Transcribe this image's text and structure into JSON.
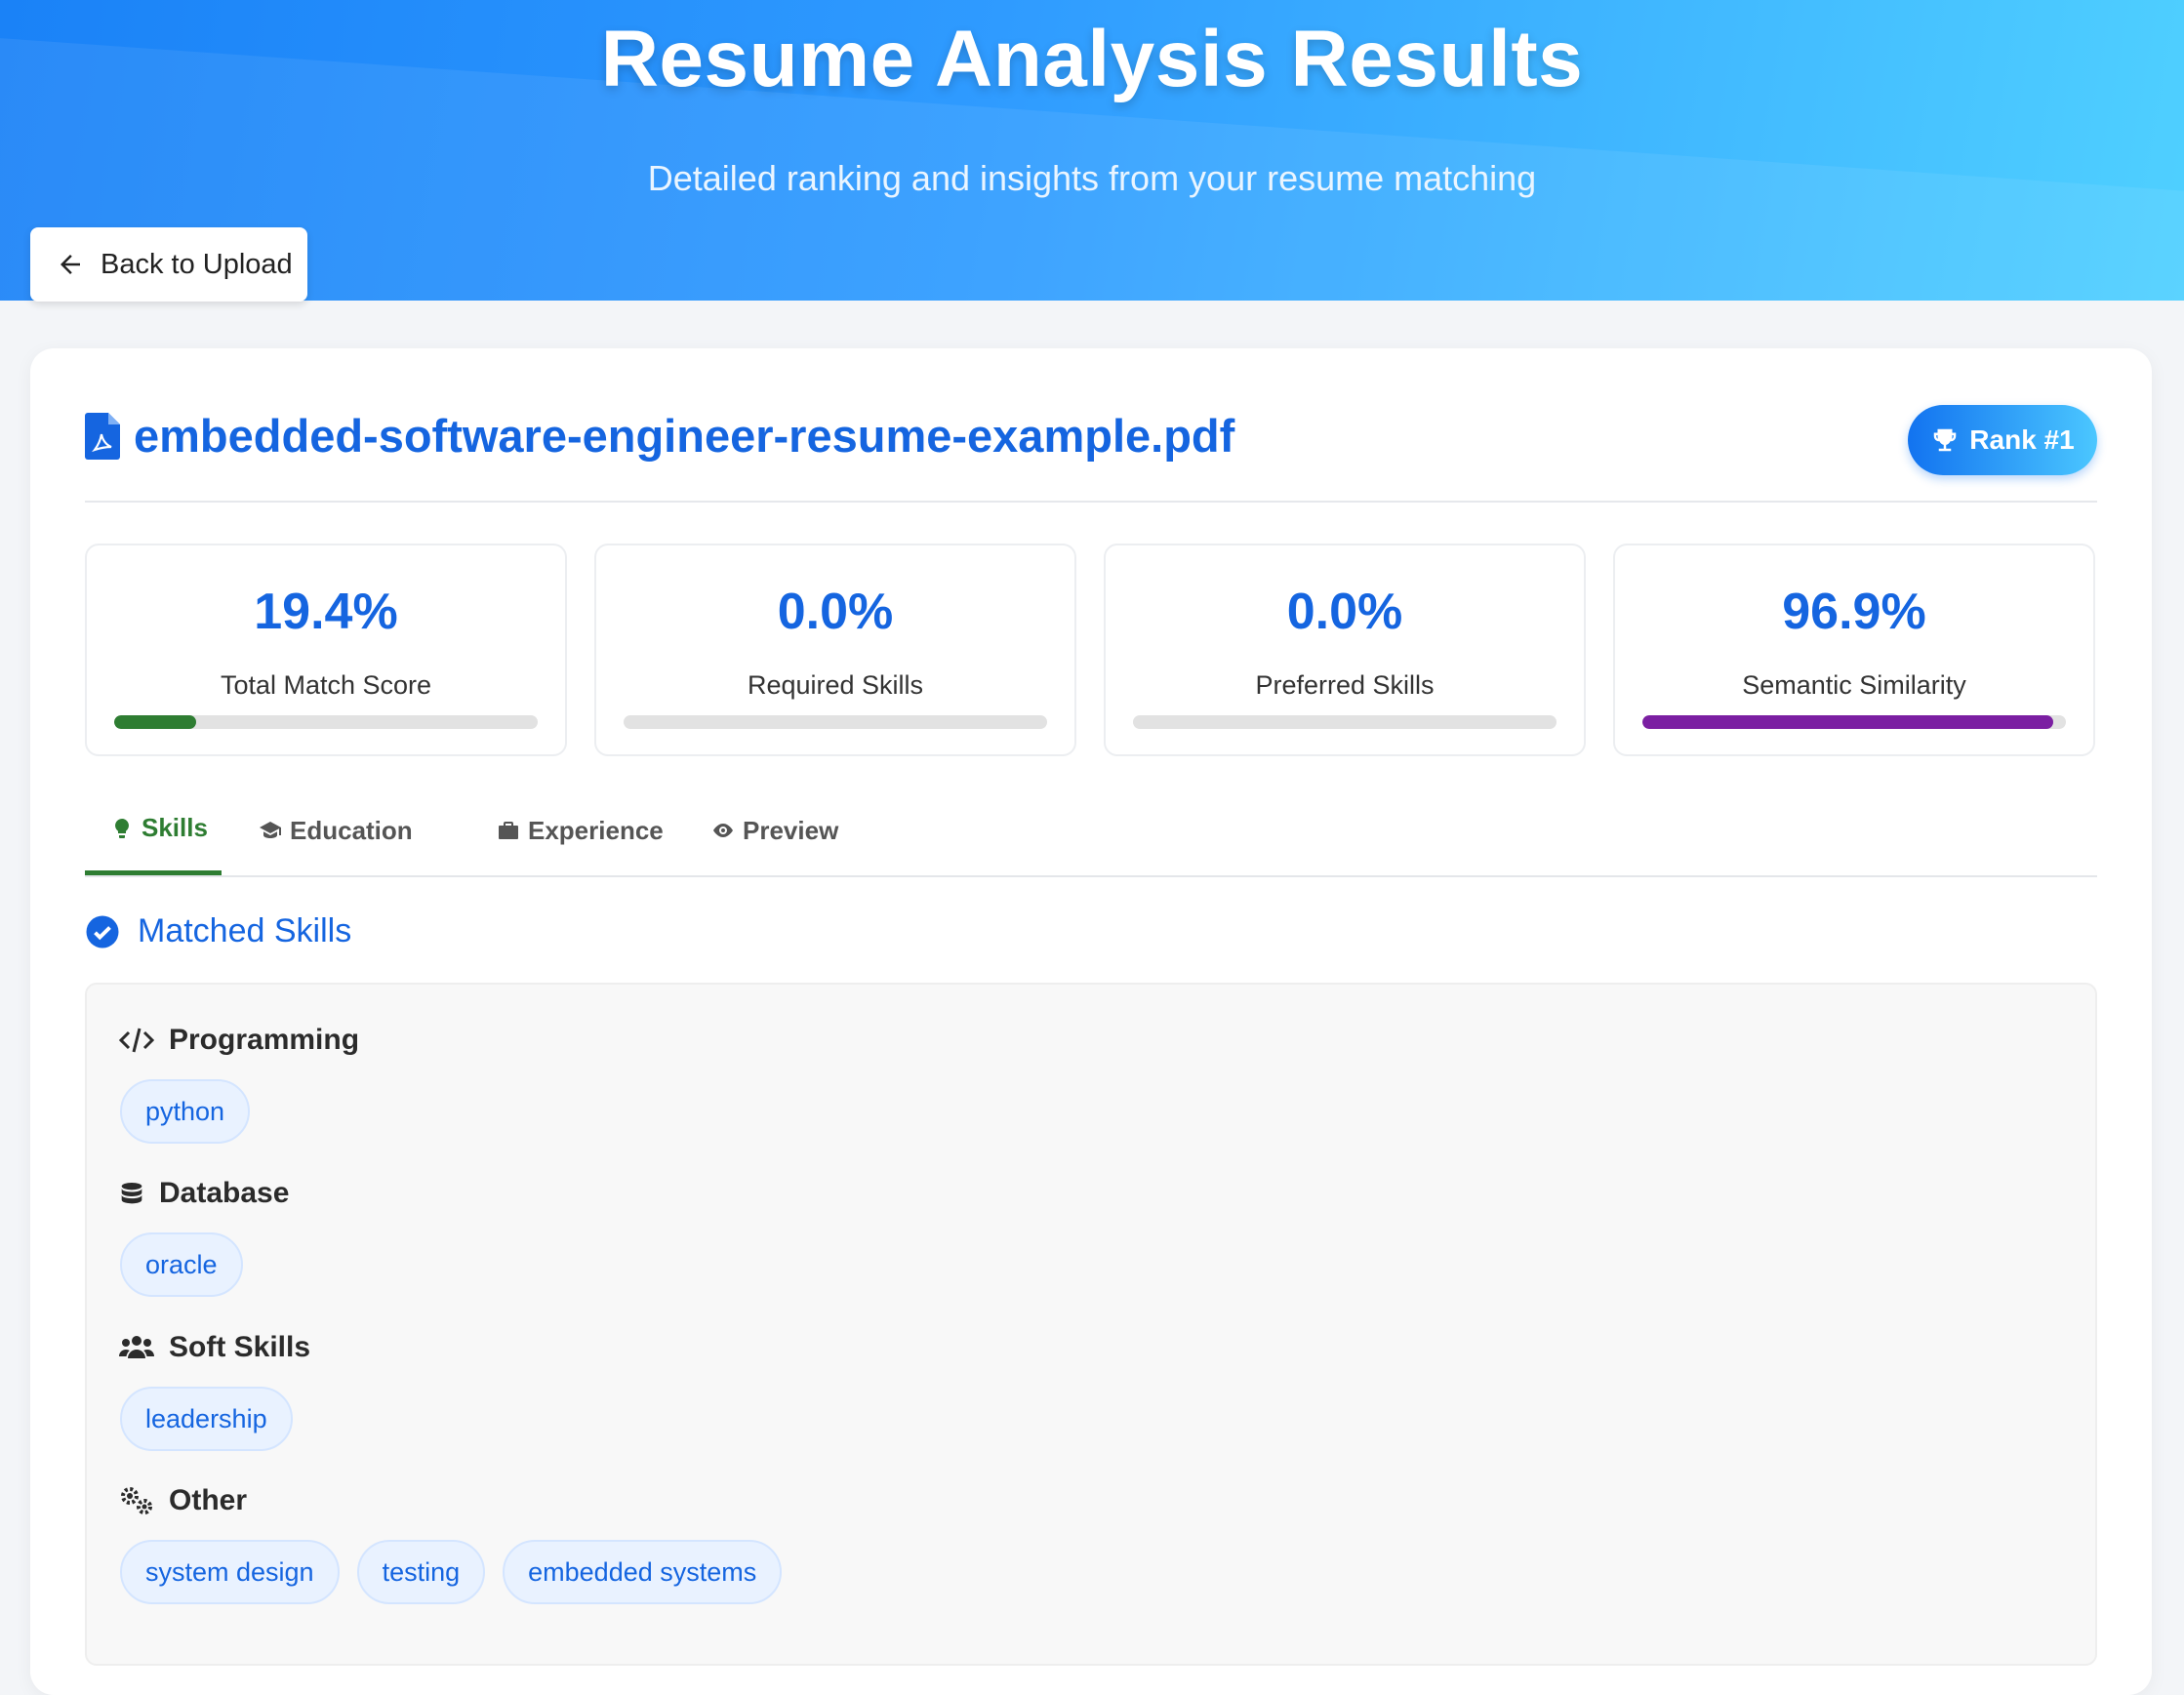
{
  "header": {
    "title": "Resume Analysis Results",
    "subtitle": "Detailed ranking and insights from your resume matching",
    "back_label": "Back to Upload"
  },
  "file": {
    "name": "embedded-software-engineer-resume-example.pdf",
    "icon": "file-pdf-icon",
    "rank_label": "Rank #1"
  },
  "metrics": [
    {
      "value": "19.4%",
      "label": "Total Match Score",
      "fraction": 0.194,
      "color": "#2e7d32"
    },
    {
      "value": "0.0%",
      "label": "Required Skills",
      "fraction": 0.0,
      "color": "#1565e0"
    },
    {
      "value": "0.0%",
      "label": "Preferred Skills",
      "fraction": 0.0,
      "color": "#1565e0"
    },
    {
      "value": "96.9%",
      "label": "Semantic Similarity",
      "fraction": 0.969,
      "color": "#7b1fa2"
    }
  ],
  "tabs": [
    {
      "label": "Skills",
      "icon": "lightbulb-icon",
      "active": true
    },
    {
      "label": "Education",
      "icon": "graduation-cap-icon",
      "active": false
    },
    {
      "label": "Experience",
      "icon": "briefcase-icon",
      "active": false
    },
    {
      "label": "Preview",
      "icon": "eye-icon",
      "active": false
    }
  ],
  "matched": {
    "title": "Matched Skills",
    "groups": [
      {
        "name": "Programming",
        "icon": "code-icon",
        "skills": [
          "python"
        ]
      },
      {
        "name": "Database",
        "icon": "database-icon",
        "skills": [
          "oracle"
        ]
      },
      {
        "name": "Soft Skills",
        "icon": "users-icon",
        "skills": [
          "leadership"
        ]
      },
      {
        "name": "Other",
        "icon": "gears-icon",
        "skills": [
          "system design",
          "testing",
          "embedded systems"
        ]
      }
    ]
  },
  "colors": {
    "accent": "#1565e0",
    "active_tab": "#2e7d32",
    "hero_start": "#1a82f7",
    "hero_end": "#4fd0ff"
  }
}
